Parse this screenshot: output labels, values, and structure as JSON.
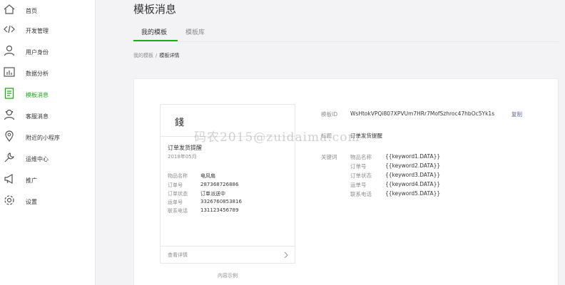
{
  "sidebar": {
    "items": [
      {
        "label": "首页",
        "icon": "home-icon"
      },
      {
        "label": "开发管理",
        "icon": "code-icon"
      },
      {
        "label": "用户身份",
        "icon": "user-icon"
      },
      {
        "label": "数据分析",
        "icon": "bar-chart-icon"
      },
      {
        "label": "模板消息",
        "icon": "document-icon",
        "active": true
      },
      {
        "label": "客服消息",
        "icon": "customer-service-icon"
      },
      {
        "label": "附近的小程序",
        "icon": "location-icon"
      },
      {
        "label": "运维中心",
        "icon": "wrench-icon"
      },
      {
        "label": "推广",
        "icon": "megaphone-icon"
      },
      {
        "label": "设置",
        "icon": "gear-icon"
      }
    ],
    "active_color": "#1aad19"
  },
  "header": {
    "title": "模板消息"
  },
  "tabs": [
    {
      "label": "我的模板",
      "active": true
    },
    {
      "label": "模板库",
      "active": false
    }
  ],
  "breadcrumb": {
    "parent": "我的模板",
    "separator": "/",
    "current": "模板详情"
  },
  "preview": {
    "logo": "錢",
    "title": "订单发货提醒",
    "date": "2018年05月",
    "rows": [
      {
        "key": "物品名称",
        "value": "电风扇"
      },
      {
        "key": "订单号",
        "value": "287368726886"
      },
      {
        "key": "订单状态",
        "value": "订单派送中"
      },
      {
        "key": "运单号",
        "value": "3326760853816"
      },
      {
        "key": "联系电话",
        "value": "131123456789"
      }
    ],
    "detail_link": "查看详情",
    "caption": "内容示例"
  },
  "info": {
    "template_id_label": "模板ID",
    "template_id": "WsHtokVPQi807XPVUm7HRr7MofSzhroc47hbOc5Yk1s",
    "copy_label": "复制",
    "title_label": "标题",
    "title_value": "订单发货提醒",
    "keywords_label": "关键词",
    "keywords": [
      {
        "name": "物品名称",
        "data": "{{keyword1.DATA}}"
      },
      {
        "name": "订单号",
        "data": "{{keyword2.DATA}}"
      },
      {
        "name": "订单状态",
        "data": "{{keyword3.DATA}}"
      },
      {
        "name": "运单号",
        "data": "{{keyword4.DATA}}"
      },
      {
        "name": "联系电话",
        "data": "{{keyword5.DATA}}"
      }
    ]
  },
  "watermark": "码农2015@zuidaima.com"
}
